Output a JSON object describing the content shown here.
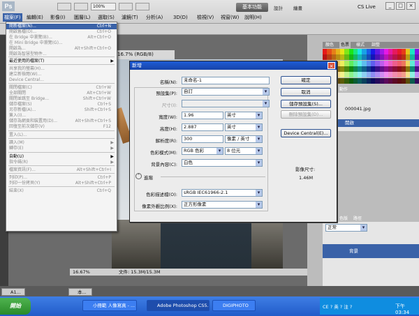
{
  "app": {
    "logo": "Ps",
    "menus": [
      "檔案(F)",
      "編輯(E)",
      "影像(I)",
      "圖層(L)",
      "選取(S)",
      "濾鏡(T)",
      "分析(A)",
      "3D(D)",
      "檢視(V)",
      "視窗(W)",
      "說明(H)"
    ],
    "zoom": "100%",
    "workspace_button": "基本功能",
    "workspace_links": [
      "設計",
      "繪畫"
    ],
    "cs_live": "CS Live",
    "window_controls": [
      "_",
      "□",
      "×"
    ]
  },
  "document": {
    "tab": "16.7% (RGB/8)",
    "status_zoom": "16.67%",
    "status_doc": "文件: 15.3M/15.3M"
  },
  "file_menu": {
    "items": [
      {
        "label": "開新檔案(N)...",
        "shortcut": "Ctrl+N",
        "state": "selected"
      },
      {
        "label": "開啟舊檔(O)...",
        "shortcut": "Ctrl+O",
        "state": "dim"
      },
      {
        "label": "在 Bridge 中瀏覽(B)...",
        "shortcut": "Alt+Ctrl+O",
        "state": "dim"
      },
      {
        "label": "在 Mini Bridge 中瀏覽(G)...",
        "shortcut": "",
        "state": "dim"
      },
      {
        "label": "開啟為...",
        "shortcut": "Alt+Shift+Ctrl+O",
        "state": "dim"
      },
      {
        "label": "開啟為智慧型物件...",
        "shortcut": "",
        "state": "dim"
      },
      {
        "label": "最近使用的檔案(T)",
        "shortcut": "",
        "state": "submenu"
      },
      {
        "label": "共享我的螢幕(H)...",
        "shortcut": "",
        "state": "dim"
      },
      {
        "label": "建立新檢閱(W)...",
        "shortcut": "",
        "state": "dim"
      },
      {
        "label": "Device Central...",
        "shortcut": "",
        "state": "dim"
      },
      {
        "label": "關閉檔案(C)",
        "shortcut": "Ctrl+W",
        "state": "dim"
      },
      {
        "label": "全部關閉",
        "shortcut": "Alt+Ctrl+W",
        "state": "dim"
      },
      {
        "label": "關閉並跳至 Bridge...",
        "shortcut": "Shift+Ctrl+W",
        "state": "dim"
      },
      {
        "label": "儲存檔案(S)",
        "shortcut": "Ctrl+S",
        "state": "dim"
      },
      {
        "label": "另存新檔(A)...",
        "shortcut": "Shift+Ctrl+S",
        "state": "dim"
      },
      {
        "label": "簽入(I)...",
        "shortcut": "",
        "state": "dim"
      },
      {
        "label": "儲存為網頁和裝置用(D)...",
        "shortcut": "Alt+Shift+Ctrl+S",
        "state": "dim"
      },
      {
        "label": "回復至前次儲存(V)",
        "shortcut": "F12",
        "state": "dim"
      },
      {
        "label": "置入(L)...",
        "shortcut": "",
        "state": "dim"
      },
      {
        "label": "讀入(M)",
        "shortcut": "",
        "state": "submenu-dim"
      },
      {
        "label": "轉存(E)",
        "shortcut": "",
        "state": "submenu-dim"
      },
      {
        "label": "自動(U)",
        "shortcut": "",
        "state": "submenu"
      },
      {
        "label": "指令碼(R)",
        "shortcut": "",
        "state": "submenu-dim"
      },
      {
        "label": "檔案資訊(F)...",
        "shortcut": "Alt+Shift+Ctrl+I",
        "state": "dim"
      },
      {
        "label": "列印(P)...",
        "shortcut": "Ctrl+P",
        "state": "dim"
      },
      {
        "label": "列印一份拷貝(Y)",
        "shortcut": "Alt+Shift+Ctrl+P",
        "state": "dim"
      },
      {
        "label": "結束(X)",
        "shortcut": "Ctrl+Q",
        "state": "dim"
      }
    ]
  },
  "dialog": {
    "title": "新增",
    "close": "×",
    "name_label": "名稱(N):",
    "name_value": "未命名-1",
    "preset_label": "預設集(P):",
    "preset_value": "自訂",
    "size_label": "尺寸(I):",
    "width_label": "寬度(W):",
    "width_value": "1.96",
    "width_unit": "英寸",
    "height_label": "高度(H):",
    "height_value": "2.887",
    "height_unit": "英寸",
    "res_label": "解析度(R):",
    "res_value": "300",
    "res_unit": "像素 / 英寸",
    "mode_label": "色彩模式(M):",
    "mode_value": "RGB 色彩",
    "mode_bits": "8 位元",
    "bg_label": "背景內容(C):",
    "bg_value": "白色",
    "advanced": "進階",
    "profile_label": "色彩描述檔(O):",
    "profile_value": "sRGB IEC61966-2.1",
    "aspect_label": "像素外觀比例(X):",
    "aspect_value": "正方形像素",
    "btn_ok": "確定",
    "btn_cancel": "取消",
    "btn_save_preset": "儲存預設集(S)...",
    "btn_delete_preset": "刪除預設集(D)...",
    "btn_device_central": "Device Central(E)...",
    "image_size_label": "影像尺寸:",
    "image_size_value": "1.46M"
  },
  "panels": {
    "swatch_tabs": [
      "顏色",
      "色票",
      "樣式",
      "調整"
    ],
    "history_tabs": [
      "步驟",
      "動作"
    ],
    "history_file": "000041.jpg",
    "history_open": "開啟",
    "layer_tabs": [
      "圖層",
      "色版",
      "路徑"
    ],
    "layer_mode": "正常",
    "layer_name": "背景"
  },
  "minidocs": [
    "A1...",
    "本..."
  ],
  "taskbar": {
    "start": "開始",
    "tasks": [
      "小冊範 人像寫真 - ...",
      "Adobe Photoshop CS5...",
      "DIGIPHOTO"
    ],
    "ime": "CE ? 英 ? 注 ?",
    "clock": "下午 03:34"
  },
  "colors": {
    "selection": "#3a62a8",
    "title_blue": "#1e5cd6",
    "taskbar": "#245edb"
  }
}
